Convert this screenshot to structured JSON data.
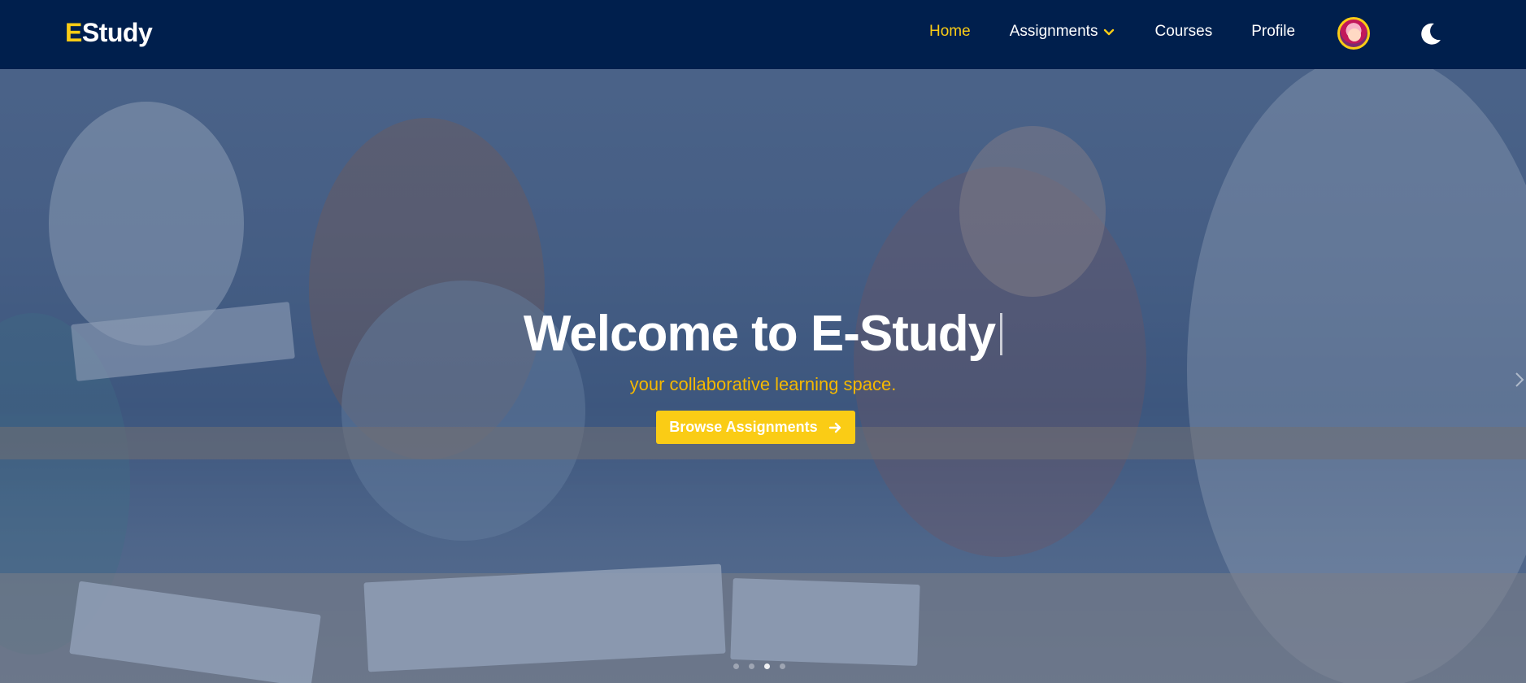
{
  "brand": {
    "prefix": "E",
    "rest": "Study"
  },
  "nav": {
    "items": [
      {
        "label": "Home",
        "active": true
      },
      {
        "label": "Assignments",
        "has_dropdown": true
      },
      {
        "label": "Courses"
      },
      {
        "label": "Profile"
      }
    ],
    "avatar_icon": "user-avatar",
    "theme_icon": "moon-icon"
  },
  "hero": {
    "title": "Welcome to E-Study",
    "subtitle": "your collaborative learning space.",
    "cta_label": "Browse Assignments",
    "cta_icon": "arrow-right-icon",
    "slides": {
      "count": 4,
      "active_index": 2
    }
  },
  "colors": {
    "navbar": "#001f4d",
    "accent": "#facc15",
    "subtitle": "#f5b800"
  }
}
